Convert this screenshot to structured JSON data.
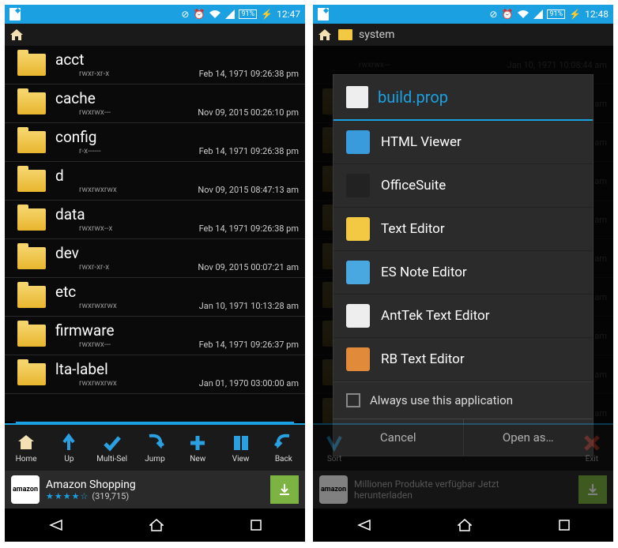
{
  "left": {
    "time": "12:47",
    "battery": "91%",
    "files": [
      {
        "name": "acct",
        "perm": "rwxr-xr-x",
        "date": "Feb 14, 1971 09:26:38 pm"
      },
      {
        "name": "cache",
        "perm": "rwxrwx---",
        "date": "Nov 09, 2015 00:26:10 pm"
      },
      {
        "name": "config",
        "perm": "r-x------",
        "date": "Feb 14, 1971 09:26:38 pm"
      },
      {
        "name": "d",
        "perm": "rwxrwxrwx",
        "date": "Nov 09, 2015 08:47:13 am"
      },
      {
        "name": "data",
        "perm": "rwxrwx--x",
        "date": "Feb 14, 1971 09:26:38 pm"
      },
      {
        "name": "dev",
        "perm": "rwxr-xr-x",
        "date": "Nov 09, 2015 00:07:21 am"
      },
      {
        "name": "etc",
        "perm": "rwxrwxrwx",
        "date": "Jan 10, 1971 10:13:28 am"
      },
      {
        "name": "firmware",
        "perm": "rwxrwx---",
        "date": "Feb 14, 1971 09:26:37 pm"
      },
      {
        "name": "lta-label",
        "perm": "rwxrwxrwx",
        "date": "Jan 01, 1970 03:00:00 am"
      }
    ],
    "toolbar": [
      {
        "label": "Home"
      },
      {
        "label": "Up"
      },
      {
        "label": "Multi-Sel"
      },
      {
        "label": "Jump"
      },
      {
        "label": "New"
      },
      {
        "label": "View"
      },
      {
        "label": "Back"
      }
    ],
    "ad": {
      "title": "Amazon Shopping",
      "stars": "★★★★☆",
      "count": "(319,715)",
      "brand": "amazon"
    }
  },
  "right": {
    "time": "12:48",
    "battery": "91%",
    "breadcrumb": "system",
    "bg_perm": "rwxrwx---",
    "bg_date": "Jan 10, 1971 10:08:44 am",
    "dialog": {
      "title": "build.prop",
      "apps": [
        {
          "name": "HTML Viewer",
          "color": "#3a9bdc"
        },
        {
          "name": "OfficeSuite",
          "color": "#222"
        },
        {
          "name": "Text Editor",
          "color": "#f3c843"
        },
        {
          "name": "ES Note Editor",
          "color": "#4aa8e0"
        },
        {
          "name": "AntTek Text Editor",
          "color": "#eee"
        },
        {
          "name": "RB Text Editor",
          "color": "#e08a3a"
        }
      ],
      "checkbox_label": "Always use this application",
      "cancel": "Cancel",
      "open": "Open as…"
    },
    "toolbar": [
      {
        "label": "Sort"
      },
      {
        "label": "Exit"
      }
    ],
    "ad": {
      "line1": "Millionen Produkte verfügbar Jetzt",
      "line2": "herunterladen",
      "brand": "amazon"
    }
  }
}
